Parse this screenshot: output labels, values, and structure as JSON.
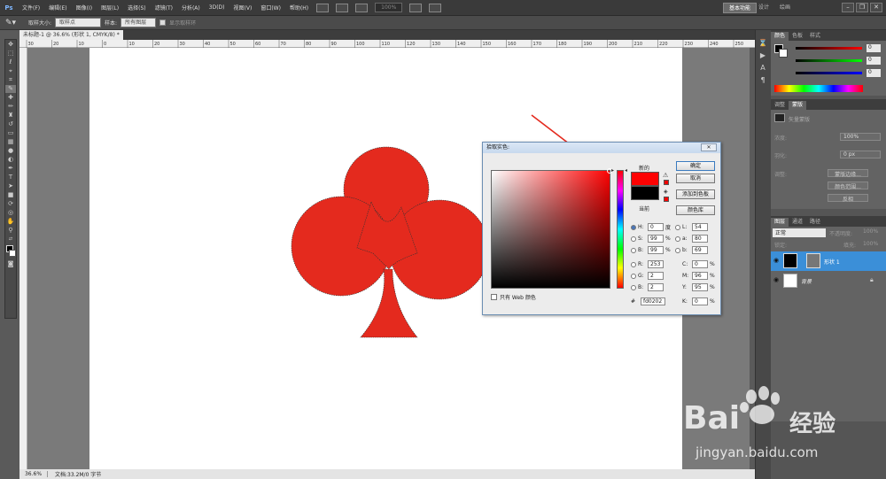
{
  "menubar": {
    "logo": "Ps",
    "items": [
      "文件(F)",
      "编辑(E)",
      "图像(I)",
      "图层(L)",
      "选择(S)",
      "滤镜(T)",
      "分析(A)",
      "3D(D)",
      "视图(V)",
      "窗口(W)",
      "帮助(H)"
    ],
    "zoom": "100%",
    "workspace_active": "基本功能",
    "workspace_2": "设计",
    "workspace_3": "绘画"
  },
  "options_bar": {
    "sample_size_label": "取样大小:",
    "sample_size_value": "取样点",
    "sample_label": "样本:",
    "sample_value": "所有图层",
    "show_ring_label": "显示取样环"
  },
  "document": {
    "tab_title": "未标题-1 @ 36.6% (形状 1, CMYK/8) *",
    "ruler_ticks": [
      "30",
      "20",
      "10",
      "0",
      "10",
      "20",
      "30",
      "40",
      "50",
      "60",
      "70",
      "80",
      "90",
      "100",
      "110",
      "120",
      "130",
      "140",
      "150",
      "160",
      "170",
      "180",
      "190",
      "200",
      "210",
      "220",
      "230",
      "240",
      "250",
      "260"
    ],
    "shape_color": "#e42a1e"
  },
  "statusbar": {
    "zoom": "36.6%",
    "doc_info": "文档:33.2M/0 字节"
  },
  "color_panel": {
    "tabs": [
      "颜色",
      "色板",
      "样式"
    ],
    "r_value": "0",
    "g_value": "0",
    "b_value": "0"
  },
  "adjust_panel": {
    "tabs": [
      "调整",
      "蒙版"
    ],
    "vector_mask_label": "矢量蒙版",
    "density_label": "浓度:",
    "density_value": "100%",
    "feather_label": "羽化:",
    "feather_value": "0 px",
    "refine_label": "调整:",
    "btn_mask_edge": "蒙版边缘...",
    "btn_color_range": "颜色范围...",
    "btn_invert": "反相"
  },
  "layers_panel": {
    "tabs": [
      "图层",
      "通道",
      "路径"
    ],
    "blend_mode": "正常",
    "opacity_label": "不透明度:",
    "opacity_value": "100%",
    "lock_label": "锁定:",
    "fill_label": "填充:",
    "fill_value": "100%",
    "layers": [
      {
        "name": "形状 1",
        "selected": true
      },
      {
        "name": "背景",
        "selected": false
      }
    ]
  },
  "dialog": {
    "title": "拾取实色:",
    "new_label": "新的",
    "current_label": "当前",
    "new_color": "#fd0202",
    "current_color": "#000000",
    "ok": "确定",
    "cancel": "取消",
    "add_to_swatches": "添加到色板",
    "color_libraries": "颜色库",
    "web_only": "只有 Web 颜色",
    "fields": {
      "H": {
        "label": "H:",
        "value": "0",
        "unit": "度"
      },
      "S": {
        "label": "S:",
        "value": "99",
        "unit": "%"
      },
      "B": {
        "label": "B:",
        "value": "99",
        "unit": "%"
      },
      "R": {
        "label": "R:",
        "value": "253",
        "unit": ""
      },
      "G": {
        "label": "G:",
        "value": "2",
        "unit": ""
      },
      "Bl": {
        "label": "B:",
        "value": "2",
        "unit": ""
      },
      "L": {
        "label": "L:",
        "value": "54",
        "unit": ""
      },
      "a": {
        "label": "a:",
        "value": "80",
        "unit": ""
      },
      "b": {
        "label": "b:",
        "value": "69",
        "unit": ""
      },
      "C": {
        "label": "C:",
        "value": "0",
        "unit": "%"
      },
      "M": {
        "label": "M:",
        "value": "96",
        "unit": "%"
      },
      "Y": {
        "label": "Y:",
        "value": "95",
        "unit": "%"
      },
      "K": {
        "label": "K:",
        "value": "0",
        "unit": "%"
      }
    },
    "hex_label": "#",
    "hex": "fd0202"
  },
  "watermark": {
    "brand": "Bai",
    "brand2": "经验",
    "url": "jingyan.baidu.com"
  },
  "annotation_arrow_color": "#e42a1e"
}
